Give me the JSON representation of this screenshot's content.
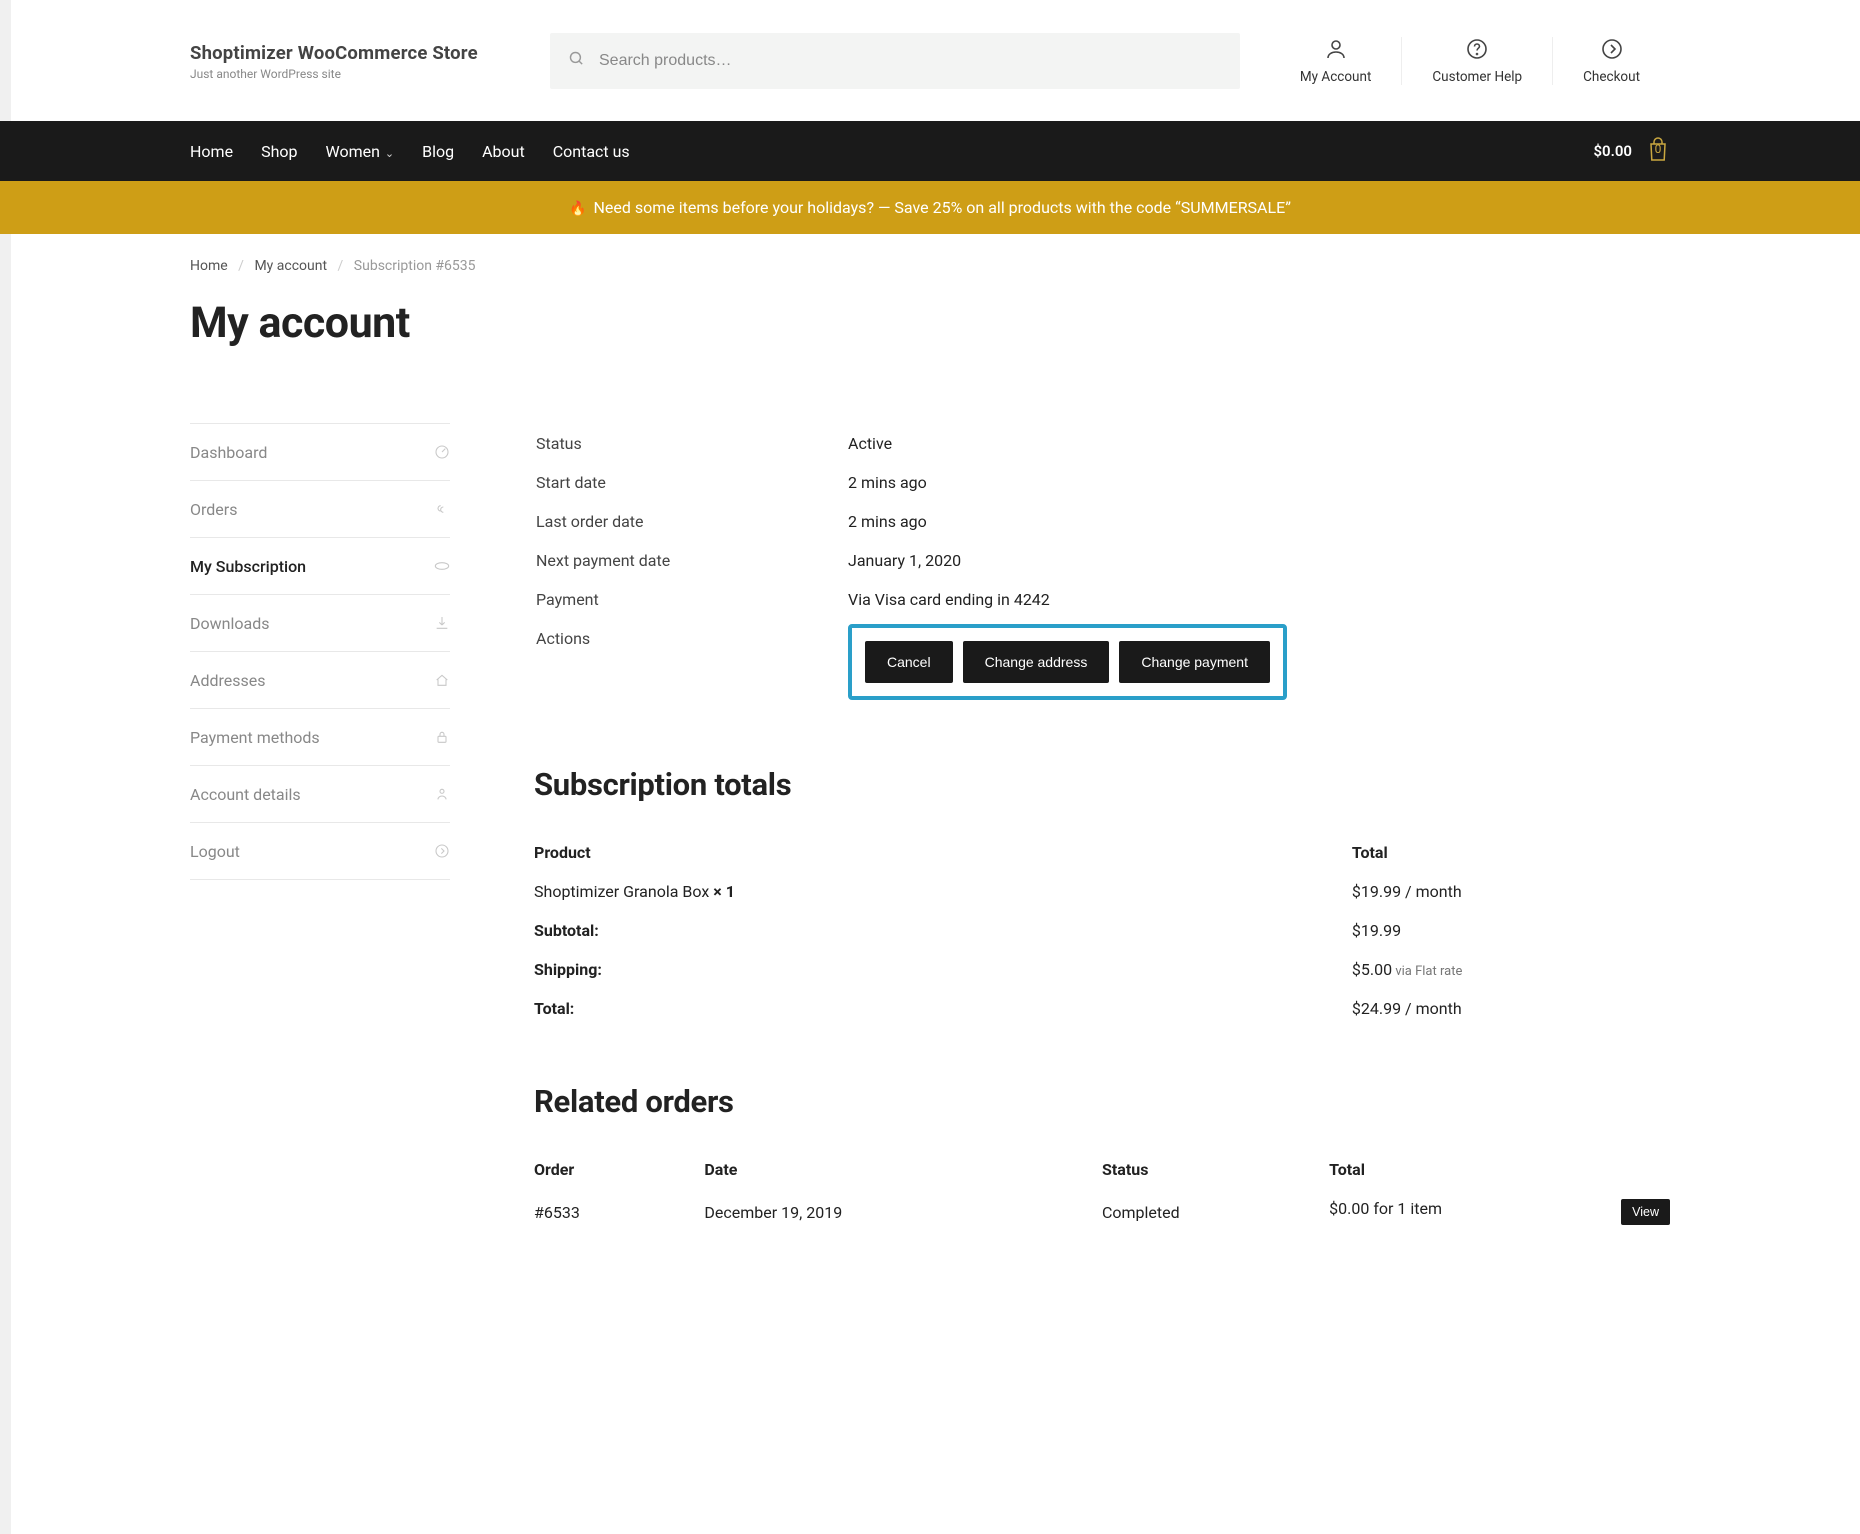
{
  "site": {
    "title": "Shoptimizer WooCommerce Store",
    "tagline": "Just another WordPress site"
  },
  "search": {
    "placeholder": "Search products…"
  },
  "topicons": {
    "account": "My Account",
    "help": "Customer Help",
    "checkout": "Checkout"
  },
  "nav": {
    "items": [
      {
        "label": "Home",
        "submenu": false
      },
      {
        "label": "Shop",
        "submenu": false
      },
      {
        "label": "Women",
        "submenu": true
      },
      {
        "label": "Blog",
        "submenu": false
      },
      {
        "label": "About",
        "submenu": false
      },
      {
        "label": "Contact us",
        "submenu": false
      }
    ],
    "cart_total": "$0.00",
    "cart_count": "0"
  },
  "promo": "Need some items before your holidays? — Save 25% on all products with the code “SUMMERSALE”",
  "crumbs": {
    "home": "Home",
    "account": "My account",
    "current": "Subscription #6535"
  },
  "page_title": "My account",
  "acctnav": [
    {
      "label": "Dashboard",
      "icon": "gauge",
      "active": false
    },
    {
      "label": "Orders",
      "icon": "link",
      "active": false
    },
    {
      "label": "My Subscription",
      "icon": "loop",
      "active": true
    },
    {
      "label": "Downloads",
      "icon": "download",
      "active": false
    },
    {
      "label": "Addresses",
      "icon": "home",
      "active": false
    },
    {
      "label": "Payment methods",
      "icon": "lock",
      "active": false
    },
    {
      "label": "Account details",
      "icon": "user",
      "active": false
    },
    {
      "label": "Logout",
      "icon": "out",
      "active": false
    }
  ],
  "sub": {
    "rows": {
      "status_label": "Status",
      "status_value": "Active",
      "start_label": "Start date",
      "start_value": "2 mins ago",
      "last_label": "Last order date",
      "last_value": "2 mins ago",
      "next_label": "Next payment date",
      "next_value": "January 1, 2020",
      "pay_label": "Payment",
      "pay_value": "Via Visa card ending in 4242",
      "actions_label": "Actions"
    },
    "actions": {
      "cancel": "Cancel",
      "change_addr": "Change address",
      "change_pay": "Change payment"
    }
  },
  "totals_heading": "Subscription totals",
  "totals": {
    "head_product": "Product",
    "head_total": "Total",
    "product_name": "Shoptimizer Granola Box ",
    "product_qty": "× 1",
    "product_price": "$19.99 / month",
    "subtotal_label": "Subtotal:",
    "subtotal_value": "$19.99",
    "shipping_label": "Shipping:",
    "shipping_value": "$5.00",
    "shipping_via": " via Flat rate",
    "total_label": "Total:",
    "total_value": "$24.99 / month"
  },
  "orders_heading": "Related orders",
  "orders": {
    "head_order": "Order",
    "head_date": "Date",
    "head_status": "Status",
    "head_total": "Total",
    "rows": [
      {
        "id": "#6533",
        "date": "December 19, 2019",
        "status": "Completed",
        "total": "$0.00 for 1 item",
        "view": "View"
      }
    ]
  }
}
